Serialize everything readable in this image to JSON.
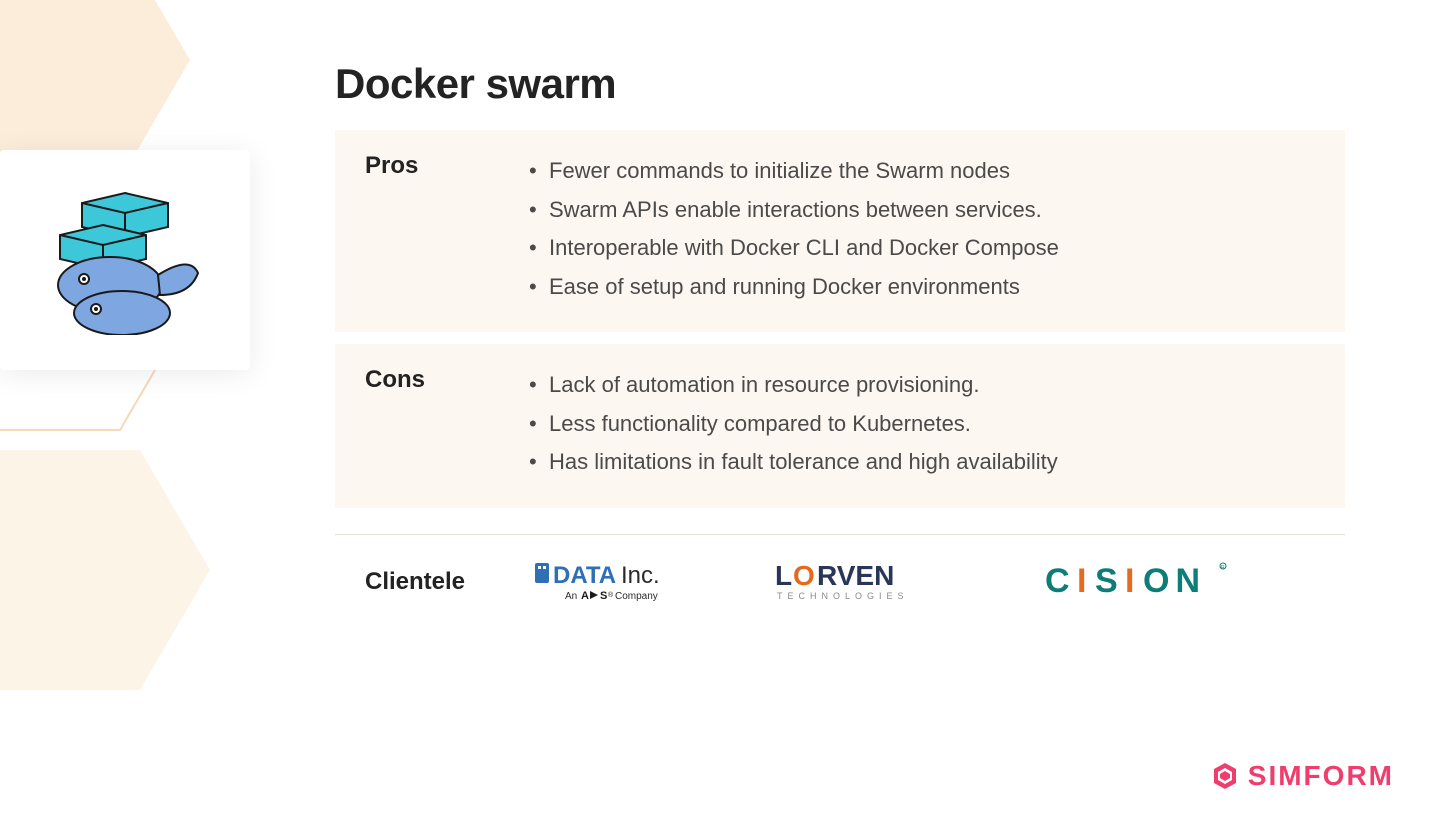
{
  "title": "Docker swarm",
  "pros": {
    "label": "Pros",
    "items": [
      "Fewer commands to initialize the Swarm nodes",
      "Swarm APIs enable interactions between services.",
      "Interoperable with Docker CLI and Docker Compose",
      "Ease of setup and running Docker environments"
    ]
  },
  "cons": {
    "label": "Cons",
    "items": [
      "Lack of automation in resource provisioning.",
      "Less functionality compared to Kubernetes.",
      "Has limitations in fault tolerance and high availability"
    ]
  },
  "clientele": {
    "label": "Clientele",
    "clients": [
      {
        "name": "DATAInc.",
        "tagline": "An ACS Company"
      },
      {
        "name": "LORVEN",
        "tagline": "TECHNOLOGIES"
      },
      {
        "name": "CISION",
        "tagline": ""
      }
    ]
  },
  "brand": "SIMFORM"
}
